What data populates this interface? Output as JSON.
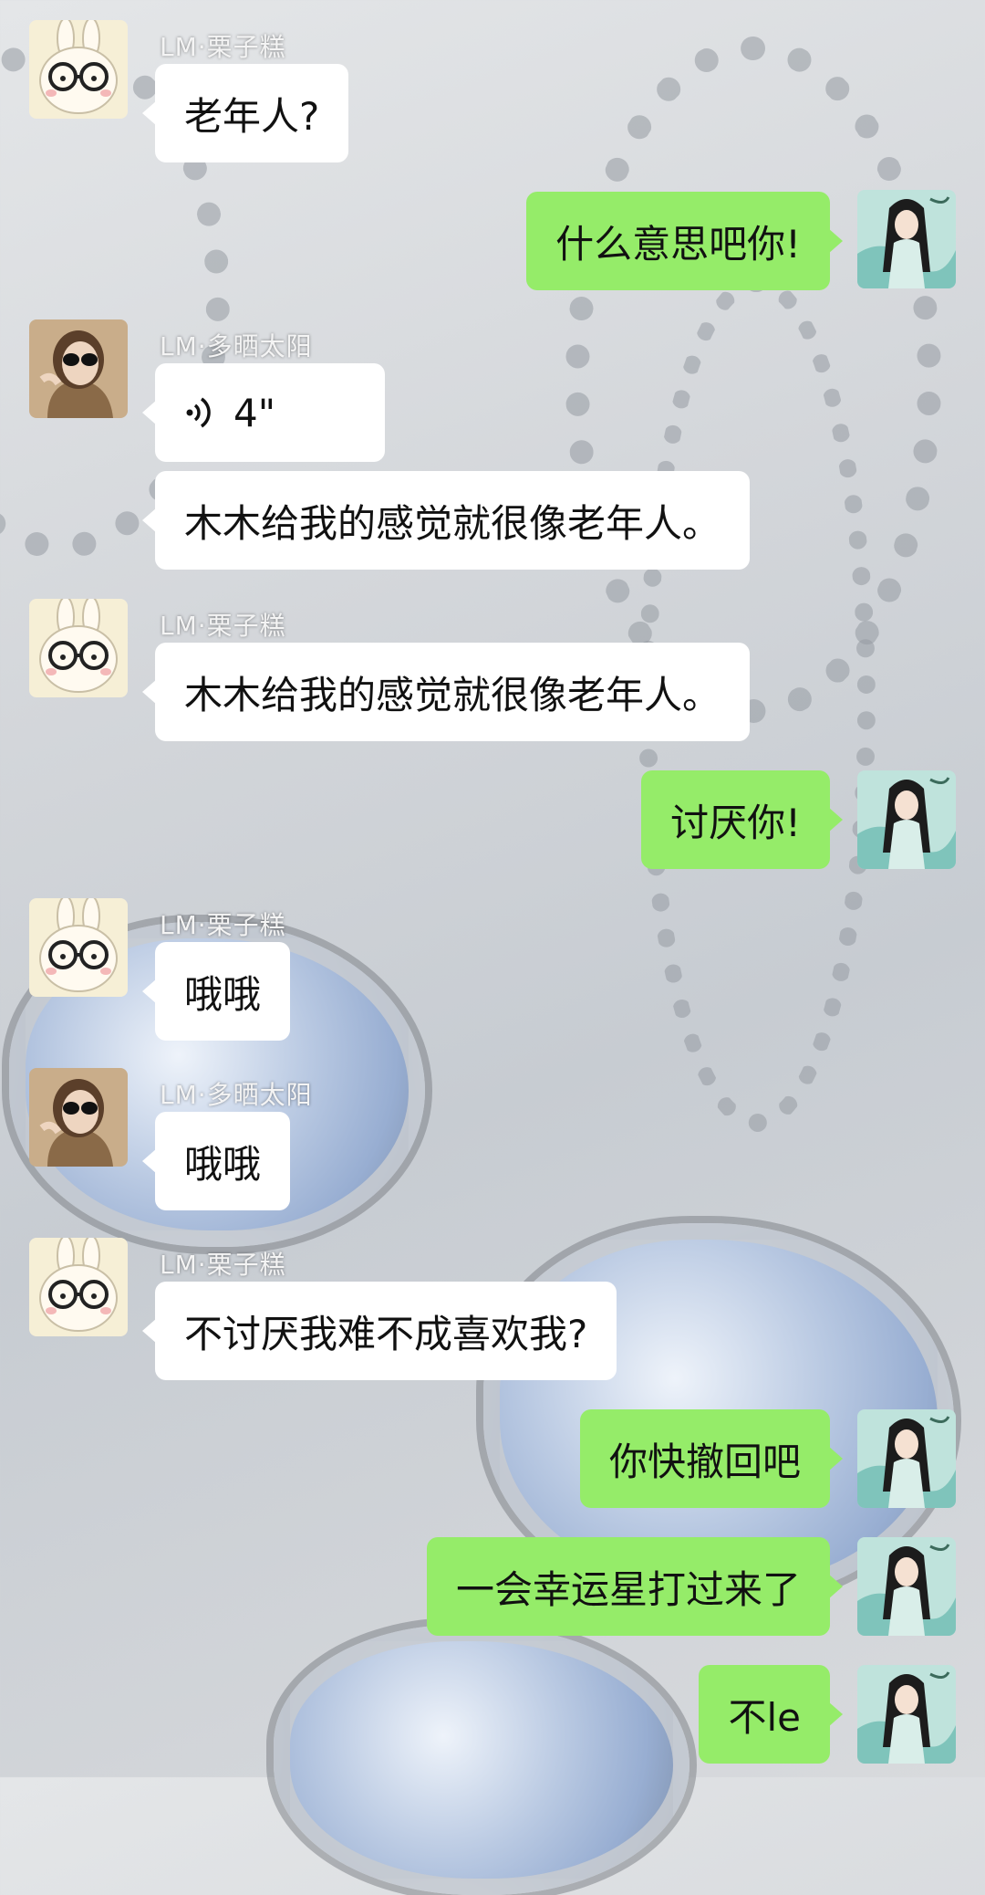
{
  "users": {
    "lizi": {
      "name": "LM·栗子糕"
    },
    "duoshai": {
      "name": "LM·多晒太阳"
    },
    "me": {}
  },
  "messages": [
    {
      "sender": "lizi",
      "text": "老年人?"
    },
    {
      "sender": "me",
      "text": "什么意思吧你!"
    },
    {
      "sender": "duoshai",
      "type": "voice",
      "duration": "4\""
    },
    {
      "sender": "duoshai",
      "text": "木木给我的感觉就很像老年人。"
    },
    {
      "sender": "lizi",
      "text": "木木给我的感觉就很像老年人。"
    },
    {
      "sender": "me",
      "text": "讨厌你!"
    },
    {
      "sender": "lizi",
      "text": "哦哦"
    },
    {
      "sender": "duoshai",
      "text": "哦哦"
    },
    {
      "sender": "lizi",
      "text": "不讨厌我难不成喜欢我?"
    },
    {
      "sender": "me",
      "text": "你快撤回吧"
    },
    {
      "sender": "me",
      "text": "一会幸运星打过来了"
    },
    {
      "sender": "me",
      "text": "不le"
    }
  ]
}
